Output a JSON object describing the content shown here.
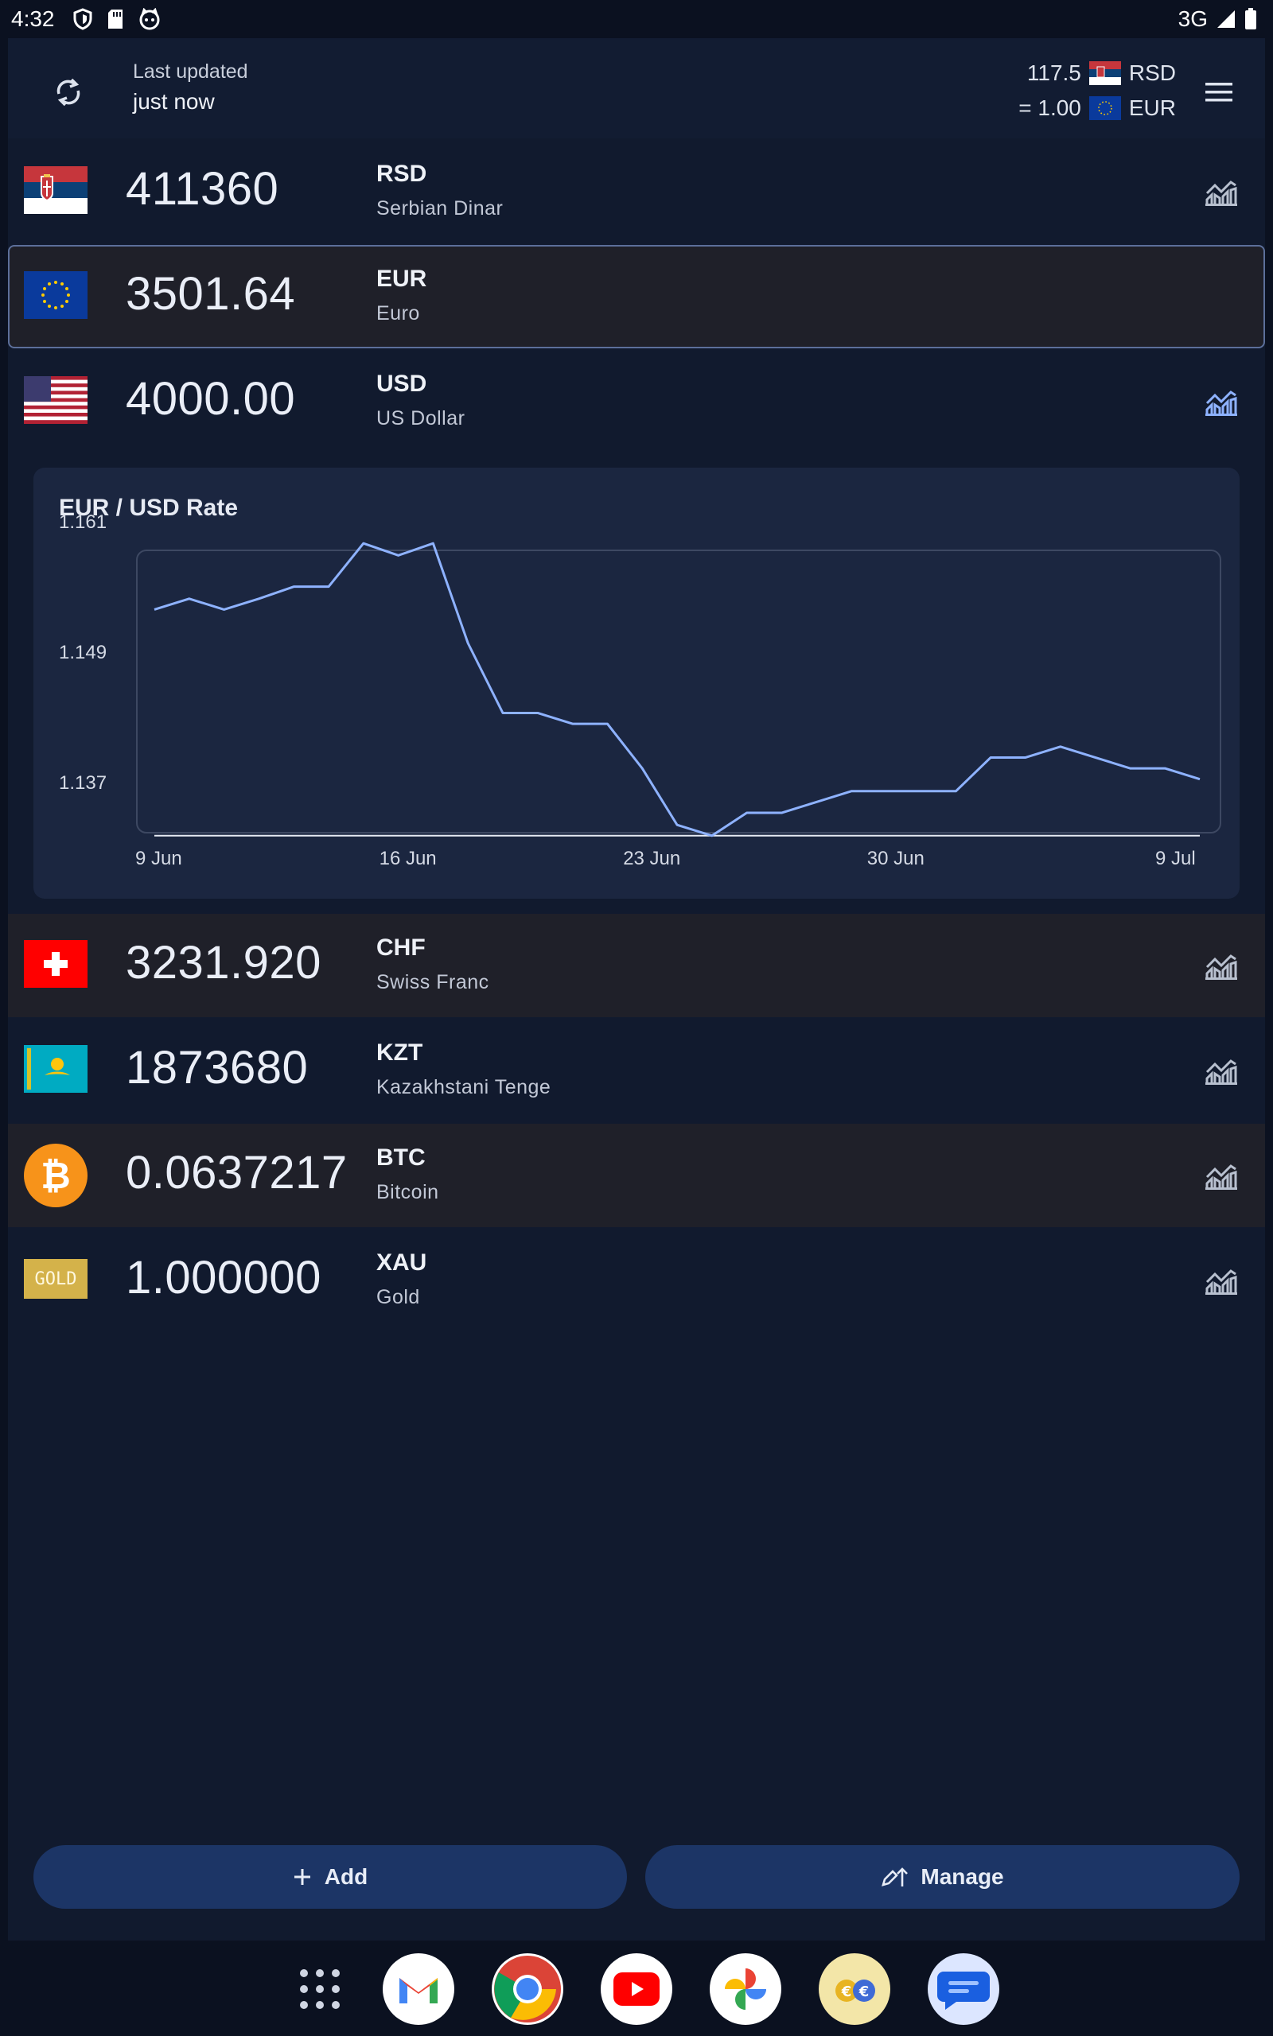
{
  "status_bar": {
    "time": "4:32",
    "network": "3G"
  },
  "header": {
    "last_updated_label": "Last updated",
    "last_updated_value": "just now",
    "rate_line1_value": "117.5",
    "rate_line1_code": "RSD",
    "rate_line2_value": "= 1.00",
    "rate_line2_code": "EUR"
  },
  "currencies": [
    {
      "amount": "411360",
      "code": "RSD",
      "name": "Serbian Dinar"
    },
    {
      "amount": "3501.64",
      "code": "EUR",
      "name": "Euro"
    },
    {
      "amount": "4000.00",
      "code": "USD",
      "name": "US Dollar"
    },
    {
      "amount": "3231.920",
      "code": "CHF",
      "name": "Swiss Franc"
    },
    {
      "amount": "1873680",
      "code": "KZT",
      "name": "Kazakhstani Tenge"
    },
    {
      "amount": "0.0637217",
      "code": "BTC",
      "name": "Bitcoin"
    },
    {
      "amount": "1.000000",
      "code": "XAU",
      "name": "Gold"
    }
  ],
  "gold_flag_text": "GOLD",
  "chart_title": "EUR / USD Rate",
  "chart_data": {
    "type": "line",
    "title": "EUR / USD Rate",
    "xlabel": "",
    "ylabel": "",
    "x_tick_labels": [
      "9 Jun",
      "16 Jun",
      "23 Jun",
      "30 Jun",
      "9 Jul"
    ],
    "y_tick_labels": [
      "1.161",
      "1.149",
      "1.137"
    ],
    "ylim": [
      1.137,
      1.161
    ],
    "grid": false,
    "series": [
      {
        "x": [
          "9 Jun",
          "10 Jun",
          "11 Jun",
          "12 Jun",
          "13 Jun",
          "14 Jun",
          "15 Jun",
          "16 Jun",
          "17 Jun",
          "18 Jun",
          "19 Jun",
          "20 Jun",
          "21 Jun",
          "22 Jun",
          "23 Jun",
          "24 Jun",
          "25 Jun",
          "26 Jun",
          "27 Jun",
          "28 Jun",
          "29 Jun",
          "30 Jun",
          "1 Jul",
          "2 Jul",
          "3 Jul",
          "4 Jul",
          "5 Jul",
          "6 Jul",
          "7 Jul",
          "8 Jul",
          "9 Jul"
        ],
        "values": [
          1.1537,
          1.1546,
          1.1537,
          1.1546,
          1.1556,
          1.1556,
          1.1592,
          1.1582,
          1.1592,
          1.1509,
          1.1451,
          1.1451,
          1.1442,
          1.1442,
          1.1405,
          1.1358,
          1.1349,
          1.1368,
          1.1368,
          1.1377,
          1.1386,
          1.1386,
          1.1386,
          1.1386,
          1.1414,
          1.1414,
          1.1423,
          1.1414,
          1.1405,
          1.1405,
          1.1396
        ]
      },
      {
        "x": [
          "9 Jun",
          "9 Jul"
        ],
        "values": [
          1.1349,
          1.1349
        ]
      }
    ]
  },
  "buttons": {
    "add": "Add",
    "manage": "Manage"
  },
  "colors": {
    "accent": "#8eb2ff",
    "line": "#8eb2ff",
    "button_bg": "#1c3566",
    "background": "#111a2e"
  },
  "dock_icons": [
    "apps-grid-icon",
    "gmail-icon",
    "chrome-icon",
    "youtube-icon",
    "photos-icon",
    "currency-converter-icon",
    "messages-icon"
  ]
}
